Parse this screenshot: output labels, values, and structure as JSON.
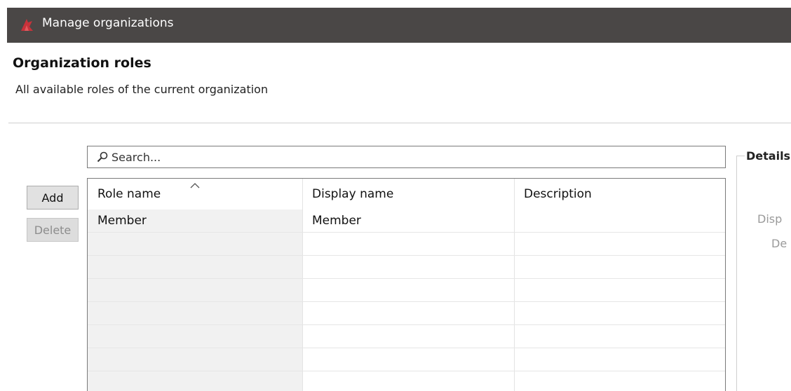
{
  "window": {
    "title": "Manage organizations"
  },
  "section": {
    "title": "Organization roles",
    "subtitle": "All available roles of the current organization"
  },
  "search": {
    "placeholder": "Search..."
  },
  "buttons": {
    "add": "Add",
    "delete": "Delete"
  },
  "table": {
    "columns": [
      "Role name",
      "Display name",
      "Description"
    ],
    "sorted_column": "Role name",
    "rows": [
      {
        "role_name": "Member",
        "display_name": "Member",
        "description": ""
      }
    ]
  },
  "details": {
    "legend": "Details",
    "fields": [
      "Disp",
      "De"
    ]
  },
  "colors": {
    "titlebar": "#4a4746",
    "brand_icon": "#c8323a"
  }
}
